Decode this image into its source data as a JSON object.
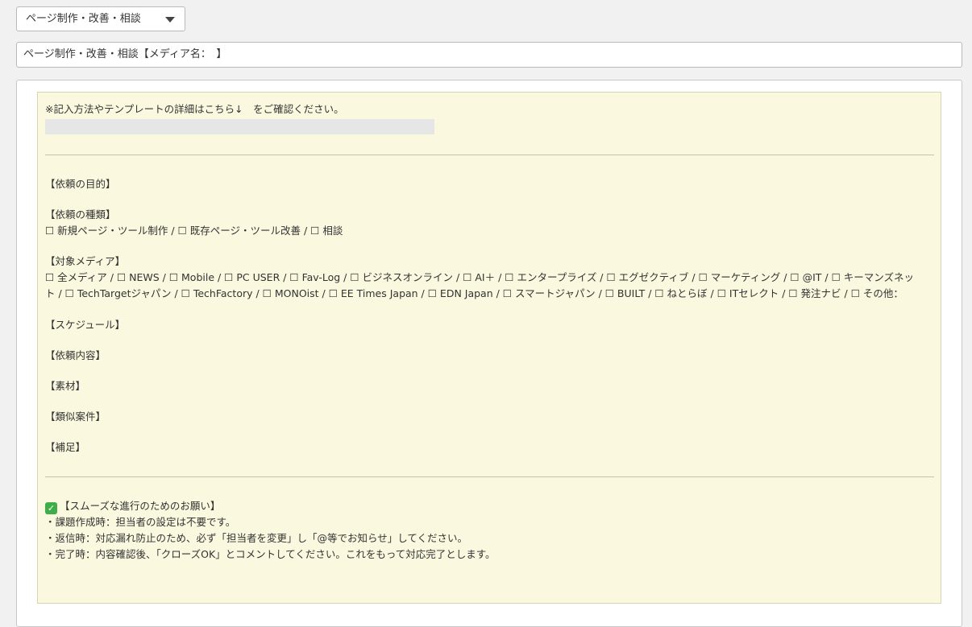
{
  "select": {
    "value": "ページ制作・改善・相談"
  },
  "title_field": {
    "value": "ページ制作・改善・相談【メディア名：　】"
  },
  "note": {
    "intro": "※記入方法やテンプレートの詳細はこちら↓　をご確認ください。",
    "purpose_heading": "【依頼の目的】",
    "type_heading": "【依頼の種類】",
    "type_options": "☐ 新規ページ・ツール制作 / ☐ 既存ページ・ツール改善 / ☐ 相談",
    "media_heading": "【対象メディア】",
    "media_line1": "☐ 全メディア / ☐ NEWS / ☐ Mobile / ☐ PC USER / ☐ Fav-Log / ☐ ビジネスオンライン / ☐ AI＋ / ☐ エンタープライズ / ☐ エグゼクティブ / ☐ マーケティング / ☐ @IT / ☐ キーマンズネッ",
    "media_line2": "ト / ☐ TechTargetジャパン / ☐ TechFactory / ☐ MONOist / ☐ EE Times Japan / ☐ EDN Japan / ☐ スマートジャパン / ☐ BUILT / ☐ ねとらぼ / ☐ ITセレクト / ☐ 発注ナビ / ☐ その他：",
    "schedule_heading": "【スケジュール】",
    "content_heading": "【依頼内容】",
    "material_heading": "【素材】",
    "similar_heading": "【類似案件】",
    "supplement_heading": "【補足】",
    "request_heading": "【スムーズな進行のためのお願い】",
    "request_line1": "・課題作成時：担当者の設定は不要です。",
    "request_line2": "・返信時：対応漏れ防止のため、必ず「担当者を変更」し「@等でお知らせ」してください。",
    "request_line3": "・完了時：内容確認後、「クローズOK」とコメントしてください。これをもって対応完了とします。"
  },
  "icons": {
    "dropdown": "chevron-down-icon",
    "check": "check-mark-button-icon"
  },
  "colors": {
    "note_background": "#faf8df",
    "check_green": "#3fae49"
  }
}
